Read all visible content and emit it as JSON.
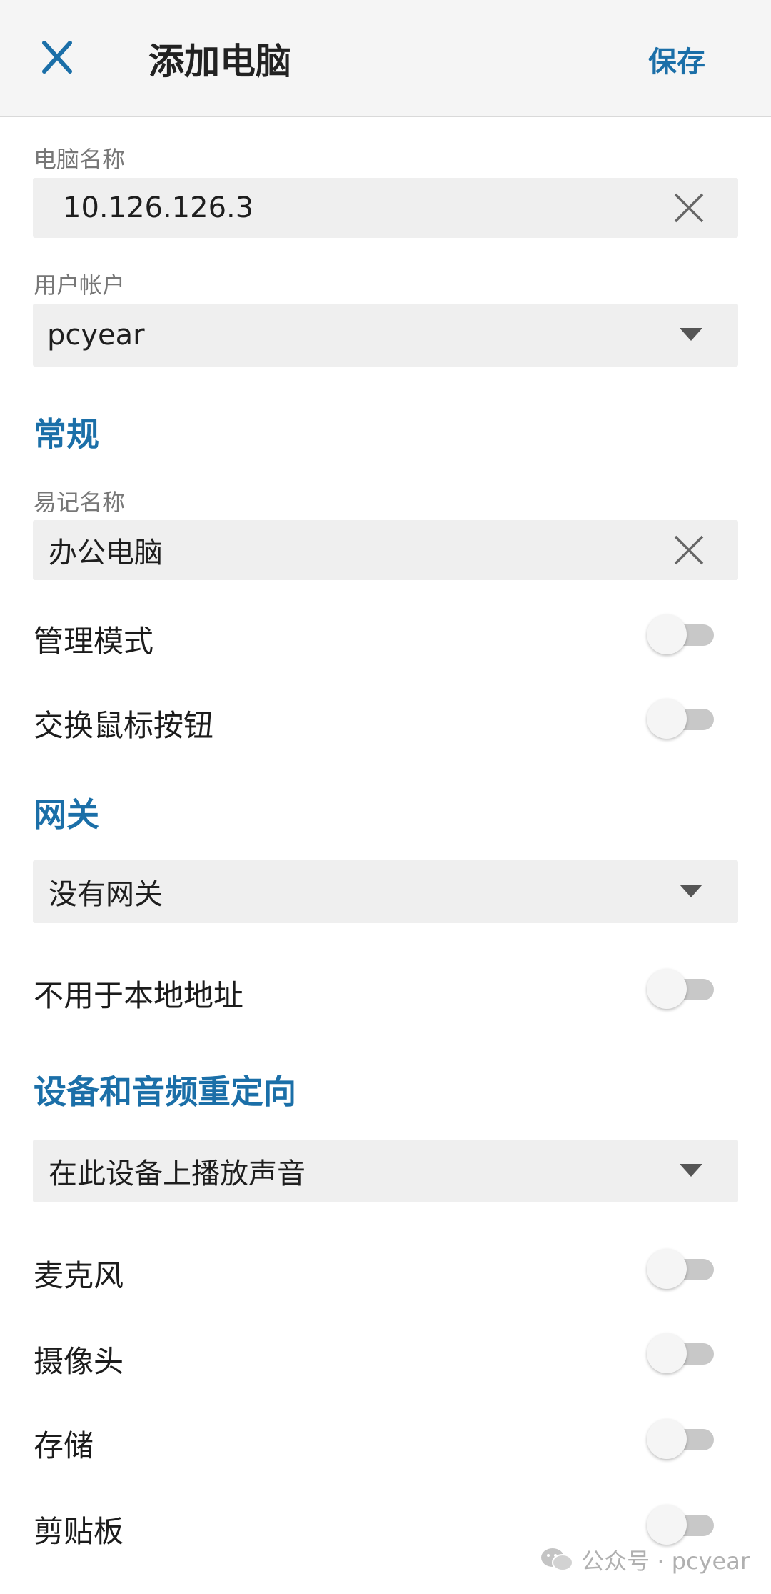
{
  "appbar": {
    "title": "添加电脑",
    "save_label": "保存",
    "close_icon": "close-icon"
  },
  "pc_name": {
    "label": "电脑名称",
    "value": "10.126.126.3"
  },
  "user_account": {
    "label": "用户帐户",
    "value": "pcyear"
  },
  "general": {
    "title": "常规",
    "friendly_name": {
      "label": "易记名称",
      "value": "办公电脑"
    },
    "admin_mode": {
      "label": "管理模式",
      "on": false
    },
    "swap_mouse": {
      "label": "交换鼠标按钮",
      "on": false
    }
  },
  "gateway": {
    "title": "网关",
    "value": "没有网关",
    "bypass_local": {
      "label": "不用于本地地址",
      "on": false
    }
  },
  "redirection": {
    "title": "设备和音频重定向",
    "sound_value": "在此设备上播放声音",
    "microphone": {
      "label": "麦克风",
      "on": false
    },
    "camera": {
      "label": "摄像头",
      "on": false
    },
    "storage": {
      "label": "存储",
      "on": false
    },
    "clipboard": {
      "label": "剪贴板",
      "on": false
    }
  },
  "watermark": {
    "text": "公众号 · pcyear",
    "icon": "wechat-icon"
  },
  "colors": {
    "accent": "#1b6fa8",
    "field_bg": "#efefef",
    "appbar_bg": "#f5f5f5"
  }
}
